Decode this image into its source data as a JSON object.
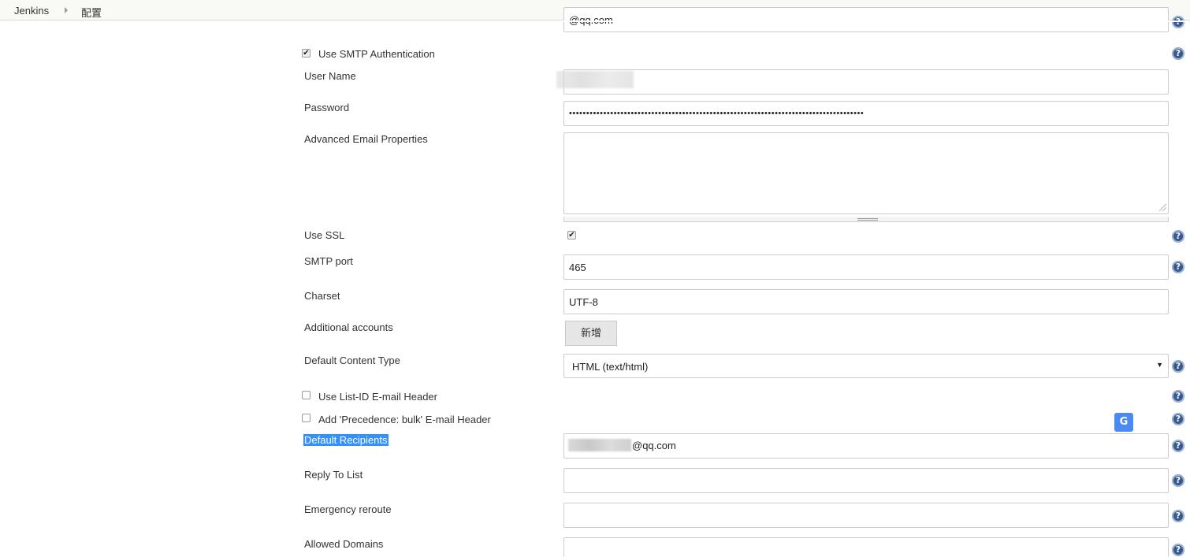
{
  "breadcrumb": {
    "items": [
      "Jenkins",
      "配置"
    ]
  },
  "form": {
    "top_field_value": "@qq.com",
    "smtp_auth": {
      "label": "Use SMTP Authentication",
      "checked": true
    },
    "user_name": {
      "label": "User Name",
      "value": ""
    },
    "password": {
      "label": "Password",
      "value": "••••••••••••••••••••••••••••••••••••••••••••••••••••••••••••••••••••••••••••••••••••••"
    },
    "advanced_props": {
      "label": "Advanced Email Properties",
      "value": ""
    },
    "use_ssl": {
      "label": "Use SSL",
      "checked": true
    },
    "smtp_port": {
      "label": "SMTP port",
      "value": "465"
    },
    "charset": {
      "label": "Charset",
      "value": "UTF-8"
    },
    "additional_accounts": {
      "label": "Additional accounts",
      "button": "新增"
    },
    "content_type": {
      "label": "Default Content Type",
      "selected": "HTML (text/html)"
    },
    "list_id": {
      "label": "Use List-ID E-mail Header",
      "checked": false
    },
    "precedence": {
      "label": "Add 'Precedence: bulk' E-mail Header",
      "checked": false
    },
    "recipients": {
      "label": "Default Recipients",
      "value_suffix": "@qq.com"
    },
    "reply_to": {
      "label": "Reply To List",
      "value": ""
    },
    "emergency": {
      "label": "Emergency reroute",
      "value": ""
    },
    "allowed_domains": {
      "label": "Allowed Domains",
      "value": ""
    }
  },
  "icons": {
    "help": "help-icon",
    "translate": "google-translate-icon",
    "check": "✔",
    "help_glyph": "?"
  },
  "colors": {
    "help_icon": "#37598c",
    "highlight": "#3390ff",
    "breadcrumb_bg": "#f9f9f5"
  }
}
